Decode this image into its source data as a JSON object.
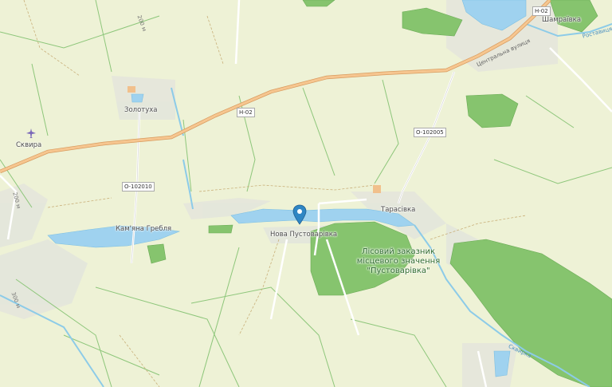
{
  "map": {
    "places": {
      "zolotukha": "Золотуха",
      "skvyra": "Сквира",
      "kamiana_hreblia": "Кам'яна Гребля",
      "nova_pustovarivka": "Нова Пустоварівка",
      "tarasivka": "Тарасівка",
      "shamraivka": "Шамраївка"
    },
    "roads": {
      "h02_a": "Н-02",
      "h02_b": "Н-02",
      "o102010": "О-102010",
      "o102005": "О-102005"
    },
    "street_labels": {
      "tsentralna": "Центральна вулиця",
      "rostavytsia": "Роставиця",
      "skvyrka": "Сквирка",
      "minor1": "200 м",
      "minor2": "200 м",
      "minor3": "300 м"
    },
    "reserve": {
      "line1": "Лісовий заказник",
      "line2": "місцевого значення",
      "line3": "\"Пустоварівка\""
    },
    "icons": {
      "marker": "map-pin-icon",
      "airport": "airplane-icon"
    },
    "colors": {
      "land": "#eef2d6",
      "forest": "#7fbf6a",
      "water": "#9cd0ee",
      "road_major": "#f0b67a",
      "marker": "#2f86c4"
    }
  }
}
